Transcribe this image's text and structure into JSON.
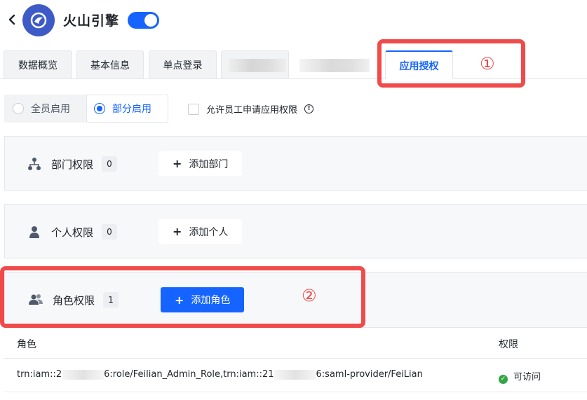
{
  "header": {
    "app_name": "火山引擎",
    "toggle_on": true
  },
  "tabs": [
    {
      "label": "数据概览",
      "active": false
    },
    {
      "label": "基本信息",
      "active": false
    },
    {
      "label": "单点登录",
      "active": false
    },
    {
      "label": "",
      "active": false,
      "redacted": true
    },
    {
      "label": "",
      "active": false,
      "redacted": true
    },
    {
      "label": "应用授权",
      "active": true
    }
  ],
  "annotations": {
    "marker_1": "①",
    "marker_2": "②"
  },
  "scope": {
    "options": [
      {
        "label": "全员启用",
        "selected": false
      },
      {
        "label": "部分启用",
        "selected": true
      }
    ],
    "allow_apply_label": "允许员工申请应用权限",
    "allow_apply_checked": false
  },
  "sections": {
    "department": {
      "label": "部门权限",
      "count": "0",
      "add_label": "添加部门",
      "icon": "org-tree-icon"
    },
    "personal": {
      "label": "个人权限",
      "count": "0",
      "add_label": "添加个人",
      "icon": "user-icon"
    },
    "role": {
      "label": "角色权限",
      "count": "1",
      "add_label": "添加角色",
      "icon": "users-icon"
    }
  },
  "table": {
    "columns": [
      "角色",
      "权限"
    ],
    "rows": [
      {
        "role_part1": "trn:iam::2",
        "role_part2": "6:role/Feilian_Admin_Role,trn:iam::21",
        "role_part3": "6:saml-provider/FeiLian",
        "permission": "可访问"
      }
    ]
  },
  "colors": {
    "primary": "#1664ff",
    "highlight": "#f04b4b",
    "success": "#32a645",
    "logo": "#3d5ac7"
  }
}
